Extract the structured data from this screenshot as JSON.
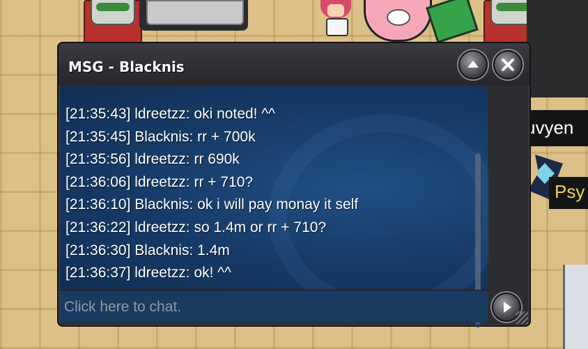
{
  "window": {
    "title": "MSG - Blacknis",
    "up_icon": "chevron-up-icon",
    "close_icon": "close-icon",
    "send_icon": "play-icon"
  },
  "messages": [
    "[21:35:43] ldreetzz: oki noted! ^^",
    "[21:35:45] Blacknis: rr + 700k",
    "[21:35:56] ldreetzz: rr 690k",
    "[21:36:06] ldreetzz: rr + 710?",
    "[21:36:10] Blacknis: ok i will pay monay it self",
    "[21:36:22] ldreetzz: so 1.4m or rr + 710?",
    "[21:36:30] Blacknis: 1.4m",
    "[21:36:37] ldreetzz: ok! ^^"
  ],
  "chat_input": {
    "placeholder": "Click here to chat.",
    "value": ""
  },
  "background": {
    "player_name_partial": "uvyen",
    "pokemon_name_partial": "Psy"
  },
  "colors": {
    "window_bg": "#2c2d31",
    "message_panel": "#163a66",
    "text": "#ffffff",
    "pokemon_label": "#f1d24a"
  }
}
